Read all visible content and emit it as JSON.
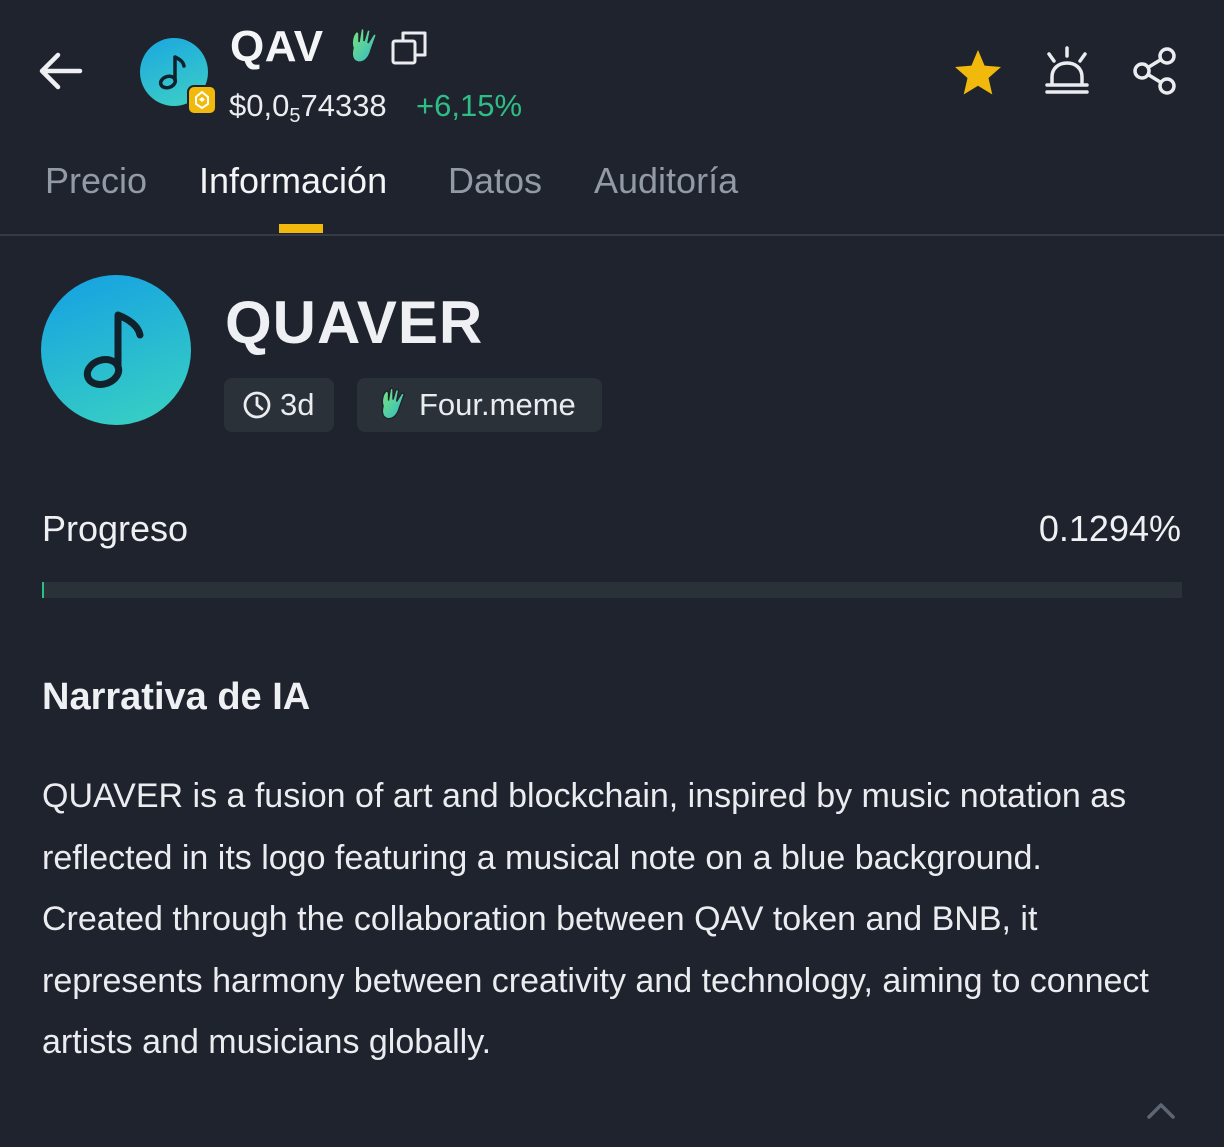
{
  "header": {
    "symbol": "QAV",
    "price_prefix": "$0,0",
    "price_zeros": "5",
    "price_digits": "74338",
    "change": "+6,15%",
    "icons": [
      "back-arrow-icon",
      "music-note-icon",
      "bnb-chain-icon",
      "wave-hand-icon",
      "copy-icon",
      "star-icon",
      "alert-siren-icon",
      "share-icon"
    ]
  },
  "tabs": [
    {
      "label": "Precio",
      "active": false
    },
    {
      "label": "Información",
      "active": true
    },
    {
      "label": "Datos",
      "active": false
    },
    {
      "label": "Auditoría",
      "active": false
    }
  ],
  "token": {
    "name": "QUAVER",
    "age": "3d",
    "platform": "Four.meme"
  },
  "progress": {
    "label": "Progreso",
    "value_text": "0.1294%",
    "percent": 0.1294
  },
  "narrative": {
    "title": "Narrativa de IA",
    "text": "QUAVER is a fusion of art and blockchain, inspired by music notation as reflected in its logo featuring a musical note on a blue background. Created through the collaboration between QAV token and BNB, it represents harmony between creativity and technology, aiming to connect artists and musicians globally."
  },
  "colors": {
    "background": "#1f232d",
    "accent_yellow": "#f0b90b",
    "positive_green": "#2ebd85",
    "muted_text": "#929aa5",
    "chip_bg": "#2b3139"
  }
}
